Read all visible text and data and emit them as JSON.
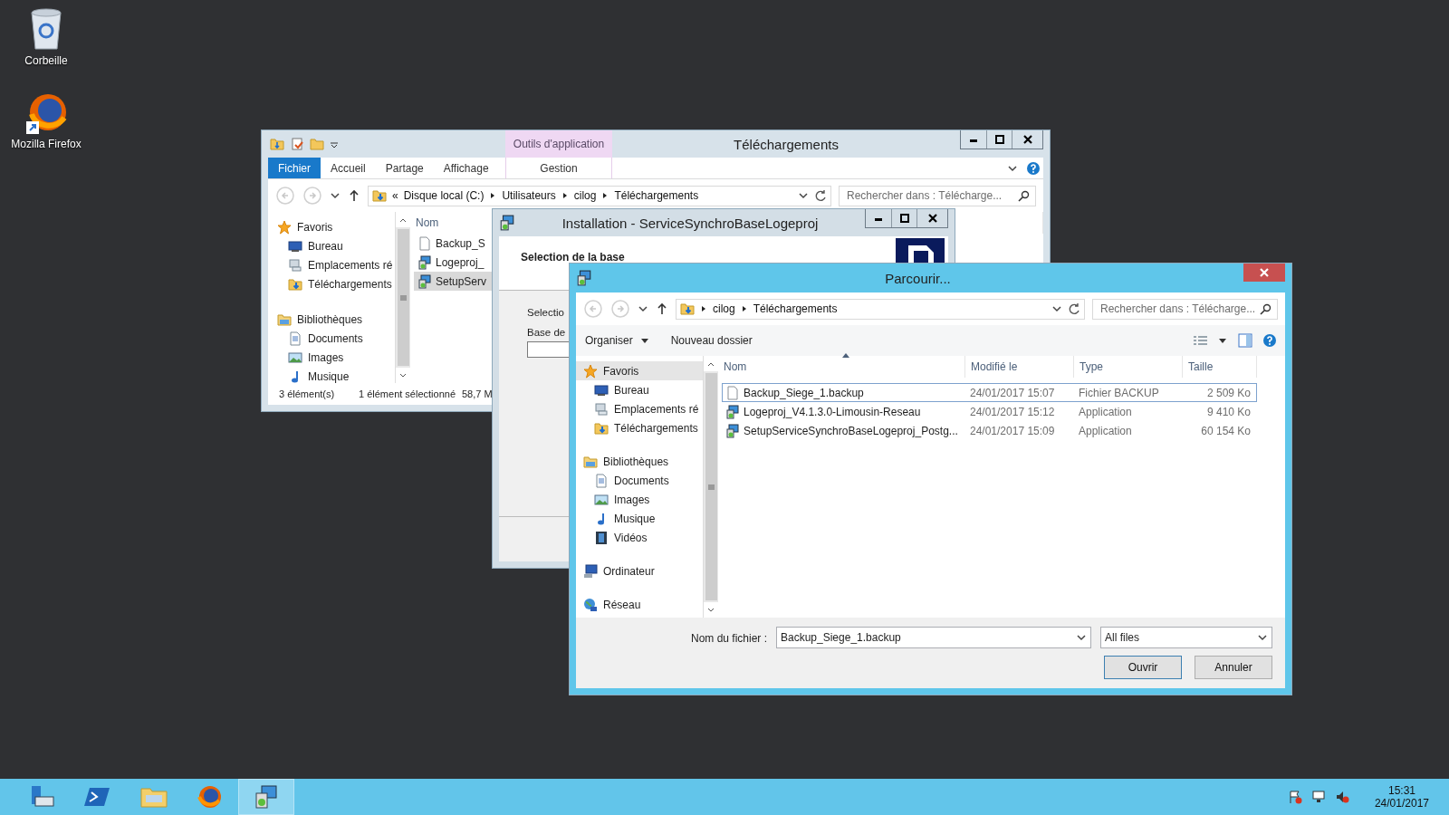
{
  "desktop_icons": [
    {
      "label": "Corbeille",
      "kind": "recycle"
    },
    {
      "label": "Mozilla Firefox",
      "kind": "firefox"
    }
  ],
  "explorer": {
    "title": "Téléchargements",
    "context_tab": "Outils d'application",
    "ribbon_tabs": [
      {
        "label": "Fichier",
        "selected": true
      },
      {
        "label": "Accueil",
        "selected": false
      },
      {
        "label": "Partage",
        "selected": false
      },
      {
        "label": "Affichage",
        "selected": false
      }
    ],
    "context_ribbon_tab": {
      "label": "Gestion",
      "selected": false
    },
    "overflow_mark": "«",
    "breadcrumb": [
      "Disque local (C:)",
      "Utilisateurs",
      "cilog",
      "Téléchargements"
    ],
    "search": {
      "placeholder": "Rechercher dans : Télécharge..."
    },
    "nav": [
      {
        "label": "Favoris",
        "kind": "star",
        "selected": false,
        "children": [
          {
            "label": "Bureau",
            "kind": "desktop",
            "selected": false
          },
          {
            "label": "Emplacements ré",
            "kind": "places",
            "selected": false
          },
          {
            "label": "Téléchargements",
            "kind": "downloads",
            "selected": false
          }
        ]
      },
      {
        "label": "Bibliothèques",
        "kind": "library",
        "selected": false,
        "children": [
          {
            "label": "Documents",
            "kind": "documents",
            "selected": false
          },
          {
            "label": "Images",
            "kind": "images",
            "selected": false
          },
          {
            "label": "Musique",
            "kind": "music",
            "selected": false
          }
        ]
      }
    ],
    "column": "Nom",
    "files": [
      {
        "name": "Backup_S",
        "kind": "doc",
        "selected": false
      },
      {
        "name": "Logeproj_",
        "kind": "setup",
        "selected": false
      },
      {
        "name": "SetupServ",
        "kind": "setup",
        "selected": true
      }
    ],
    "status": [
      "3 élément(s)",
      "1 élément sélectionné",
      "58,7 M"
    ]
  },
  "installer": {
    "title": "Installation - ServiceSynchroBaseLogeproj",
    "heading": "Selection de la base",
    "labels": [
      "Selectio",
      "Base de"
    ]
  },
  "browse": {
    "title": "Parcourir...",
    "breadcrumb": [
      "cilog",
      "Téléchargements"
    ],
    "search": {
      "placeholder": "Rechercher dans : Télécharge..."
    },
    "toolbar": [
      "Organiser",
      "Nouveau dossier"
    ],
    "nav": [
      {
        "label": "Favoris",
        "kind": "star",
        "selected": true,
        "children": [
          {
            "label": "Bureau",
            "kind": "desktop",
            "selected": false
          },
          {
            "label": "Emplacements ré",
            "kind": "places",
            "selected": false
          },
          {
            "label": "Téléchargements",
            "kind": "downloads",
            "selected": false
          }
        ]
      },
      {
        "label": "Bibliothèques",
        "kind": "library",
        "selected": false,
        "children": [
          {
            "label": "Documents",
            "kind": "documents",
            "selected": false
          },
          {
            "label": "Images",
            "kind": "images",
            "selected": false
          },
          {
            "label": "Musique",
            "kind": "music",
            "selected": false
          },
          {
            "label": "Vidéos",
            "kind": "videos",
            "selected": false
          }
        ]
      },
      {
        "label": "Ordinateur",
        "kind": "computer",
        "selected": false
      },
      {
        "label": "Réseau",
        "kind": "network",
        "selected": false
      }
    ],
    "columns": [
      "Nom",
      "Modifié le",
      "Type",
      "Taille"
    ],
    "files": [
      {
        "name": "Backup_Siege_1.backup",
        "modified": "24/01/2017 15:07",
        "type": "Fichier BACKUP",
        "size": "2 509 Ko",
        "kind": "doc",
        "selected": true
      },
      {
        "name": "Logeproj_V4.1.3.0-Limousin-Reseau",
        "modified": "24/01/2017 15:12",
        "type": "Application",
        "size": "9 410 Ko",
        "kind": "setup",
        "selected": false
      },
      {
        "name": "SetupServiceSynchroBaseLogeproj_Postg...",
        "modified": "24/01/2017 15:09",
        "type": "Application",
        "size": "60 154 Ko",
        "kind": "setup",
        "selected": false
      }
    ],
    "filename_label": "Nom du fichier :",
    "filename": "Backup_Siege_1.backup",
    "filter": "All files",
    "buttons": [
      "Ouvrir",
      "Annuler"
    ]
  },
  "taskbar": {
    "apps": [
      {
        "kind": "server",
        "selected": false
      },
      {
        "kind": "shell",
        "selected": false
      },
      {
        "kind": "explorer",
        "selected": false
      },
      {
        "kind": "firefox",
        "selected": false
      },
      {
        "kind": "setup",
        "selected": true
      }
    ],
    "time": "15:31",
    "date": "24/01/2017"
  }
}
